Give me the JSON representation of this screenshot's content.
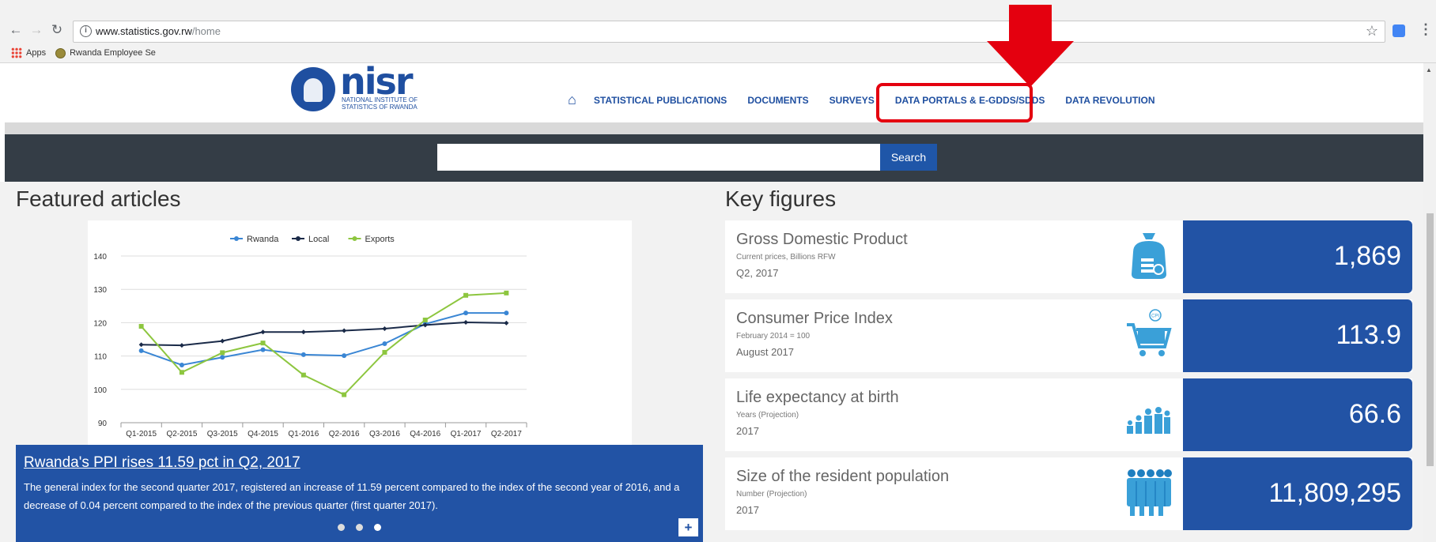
{
  "browser": {
    "url_host": "www.statistics.gov.rw",
    "url_path": "/home",
    "bookmarks": [
      {
        "label": "Apps"
      },
      {
        "label": "Rwanda Employee Se"
      }
    ]
  },
  "header": {
    "logo_word": "nisr",
    "logo_subtitle": "NATIONAL INSTITUTE OF STATISTICS OF RWANDA",
    "nav": [
      {
        "label": "STATISTICAL PUBLICATIONS"
      },
      {
        "label": "DOCUMENTS"
      },
      {
        "label": "SURVEYS"
      },
      {
        "label": "DATA PORTALS & E-GDDS/SDDS"
      },
      {
        "label": "DATA REVOLUTION"
      }
    ],
    "highlight_color": "#e4000f"
  },
  "search": {
    "value": "",
    "button_label": "Search"
  },
  "featured": {
    "title": "Featured articles",
    "article_title": "Rwanda's PPI rises 11.59 pct in Q2, 2017",
    "article_body": "The general index for the second quarter 2017, registered an increase of 11.59 percent compared to the index of the second year of 2016, and a decrease of 0.04 percent compared to the index of the previous quarter (first quarter 2017).",
    "slides": 3,
    "active_slide": 3,
    "more_label": "+"
  },
  "chart_data": {
    "type": "line",
    "x": [
      "Q1-2015",
      "Q2-2015",
      "Q3-2015",
      "Q4-2015",
      "Q1-2016",
      "Q2-2016",
      "Q3-2016",
      "Q4-2016",
      "Q1-2017",
      "Q2-2017"
    ],
    "series": [
      {
        "name": "Rwanda",
        "color": "#3a86d4",
        "marker": "circle",
        "values": [
          111.6,
          107.3,
          109.6,
          111.9,
          110.4,
          110.1,
          113.7,
          119.6,
          122.9,
          122.9
        ]
      },
      {
        "name": "Local",
        "color": "#1a2a48",
        "marker": "diamond",
        "values": [
          113.4,
          113.2,
          114.5,
          117.2,
          117.2,
          117.6,
          118.2,
          119.3,
          120.1,
          119.9
        ]
      },
      {
        "name": "Exports",
        "color": "#8dc63f",
        "marker": "square",
        "values": [
          118.9,
          105.1,
          111.0,
          113.9,
          104.3,
          98.4,
          111.1,
          120.8,
          128.2,
          128.9
        ]
      }
    ],
    "yticks": [
      90,
      100,
      110,
      120,
      130,
      140
    ],
    "ylim": [
      90,
      140
    ],
    "grid": true,
    "legend": "top"
  },
  "key_figures": {
    "title": "Key figures",
    "items": [
      {
        "name": "Gross Domestic Product",
        "note": "Current prices, Billions RFW",
        "period": "Q2, 2017",
        "value": "1,869",
        "icon": "money-bag-icon"
      },
      {
        "name": "Consumer Price Index",
        "note": "February 2014 = 100",
        "period": "August 2017",
        "value": "113.9",
        "icon": "cart-icon",
        "icon_text": "CPI"
      },
      {
        "name": "Life expectancy at birth",
        "note": "Years (Projection)",
        "period": "2017",
        "value": "66.6",
        "icon": "people-ages-icon"
      },
      {
        "name": "Size of the resident population",
        "note": "Number (Projection)",
        "period": "2017",
        "value": "11,809,295",
        "icon": "crowd-icon"
      }
    ]
  },
  "colors": {
    "brand_blue": "#2253a5",
    "nav_blue": "#1f4fa0",
    "dark_band": "#343d46",
    "icon_blue": "#3aa0d8"
  }
}
